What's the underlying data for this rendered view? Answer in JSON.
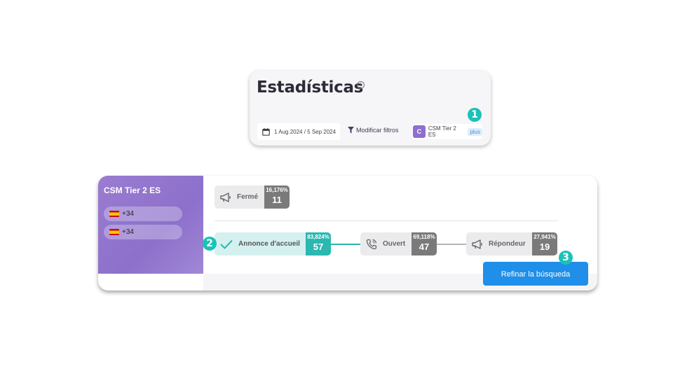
{
  "stats": {
    "title": "Estadísticas",
    "info_icon": "i",
    "date_range": "1 Aug 2024 / 5 Sep 2024",
    "filter_label": "Modificar filtros",
    "list": {
      "avatar": "C",
      "name": "CSM Tier 2 ES",
      "badge": "plus"
    }
  },
  "steps": [
    "1",
    "2",
    "3"
  ],
  "campaign": {
    "name": "CSM Tier 2 ES",
    "phones": [
      "+34",
      "+34"
    ]
  },
  "nodes": {
    "ferme": {
      "label": "Fermé",
      "pct": "16,176%",
      "count": "11",
      "icon": "megaphone-icon"
    },
    "annonce": {
      "label": "Annonce d'accueil",
      "pct": "83,824%",
      "count": "57",
      "icon": "check-icon"
    },
    "ouvert": {
      "label": "Ouvert",
      "pct": "69,118%",
      "count": "47",
      "icon": "phone-icon"
    },
    "repondeur": {
      "label": "Répondeur",
      "pct": "27,941%",
      "count": "19",
      "icon": "megaphone-icon"
    }
  },
  "refine_label": "Refinar la búsqueda",
  "colors": {
    "accent_teal": "#2ab8b0",
    "step_badge": "#1bc2b8",
    "sidebar_purple": "#8d70cb",
    "primary_blue": "#1f8fe9",
    "node_gray": "#7a7a7a"
  }
}
